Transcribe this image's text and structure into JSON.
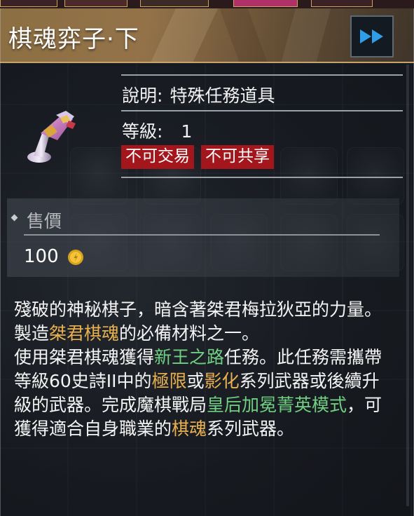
{
  "item": {
    "title": "棋魂弈子·下",
    "description_label": "說明:",
    "description_value": "特殊任務道具",
    "level_label": "等級:",
    "level_value": "1",
    "tags": [
      "不可交易",
      "不可共享"
    ]
  },
  "price": {
    "label": "售價",
    "value": "100"
  },
  "description": {
    "p1": "殘破的神秘棋子，暗含著桀君梅拉狄亞的力量。",
    "p2_a": "製造",
    "p2_hl": "桀君棋魂",
    "p2_b": "的必備材料之一。",
    "p3_a": "使用桀君棋魂獲得",
    "p3_hl1": "新王之路",
    "p3_b": "任務。此任務需攜帶等級60史詩II中的",
    "p3_hl2": "極限",
    "p3_c": "或",
    "p3_hl3": "影化",
    "p3_d": "系列武器或後續升級的武器。完成魔棋戰局",
    "p3_hl4": "皇后加冕菁英模式",
    "p3_e": "，可獲得適合自身職業的",
    "p3_hl5": "棋魂",
    "p3_f": "系列武器。"
  },
  "colors": {
    "highlight_gold": "#e8b04f",
    "highlight_green": "#6fd081",
    "tag_red": "#a3161c",
    "header_gold": "#c8a46c"
  },
  "icons": {
    "item": "chess-piece-icon",
    "next": "fast-forward-icon",
    "currency": "gold-coin-icon"
  }
}
